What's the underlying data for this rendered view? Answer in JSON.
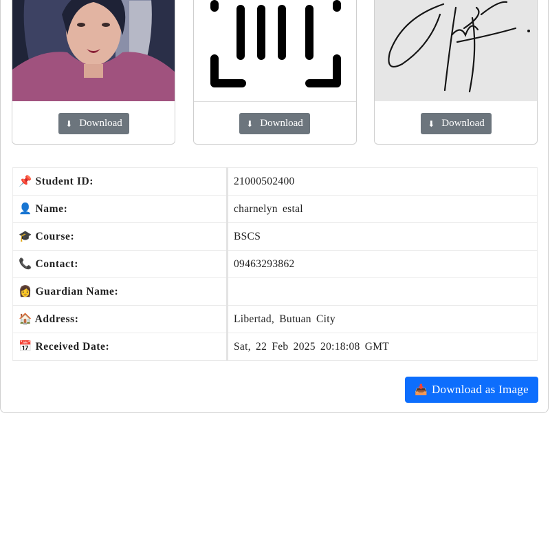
{
  "cards": [
    {
      "image": "photo-icon",
      "button_icon": "⬇",
      "button_label": "Download"
    },
    {
      "image": "barcode-scan-icon",
      "button_icon": "⬇",
      "button_label": "Download"
    },
    {
      "image": "signature-icon",
      "button_icon": "⬇",
      "button_label": "Download"
    }
  ],
  "details": [
    {
      "icon": "📌",
      "label": "Student ID:",
      "value": "21000502400"
    },
    {
      "icon": "👤",
      "label": "Name:",
      "value": "charnelyn estal"
    },
    {
      "icon": "🎓",
      "label": "Course:",
      "value": "BSCS"
    },
    {
      "icon": "📞",
      "label": "Contact:",
      "value": "09463293862"
    },
    {
      "icon": "👩",
      "label": "Guardian Name:",
      "value": ""
    },
    {
      "icon": "🏠",
      "label": "Address:",
      "value": "Libertad, Butuan City"
    },
    {
      "icon": "📅",
      "label": "Received Date:",
      "value": "Sat, 22 Feb 2025 20:18:08 GMT"
    }
  ],
  "download_image_button": {
    "icon": "📥",
    "label": "Download as Image"
  },
  "colors": {
    "primary": "#0d6efd",
    "secondary": "#6c757d"
  }
}
